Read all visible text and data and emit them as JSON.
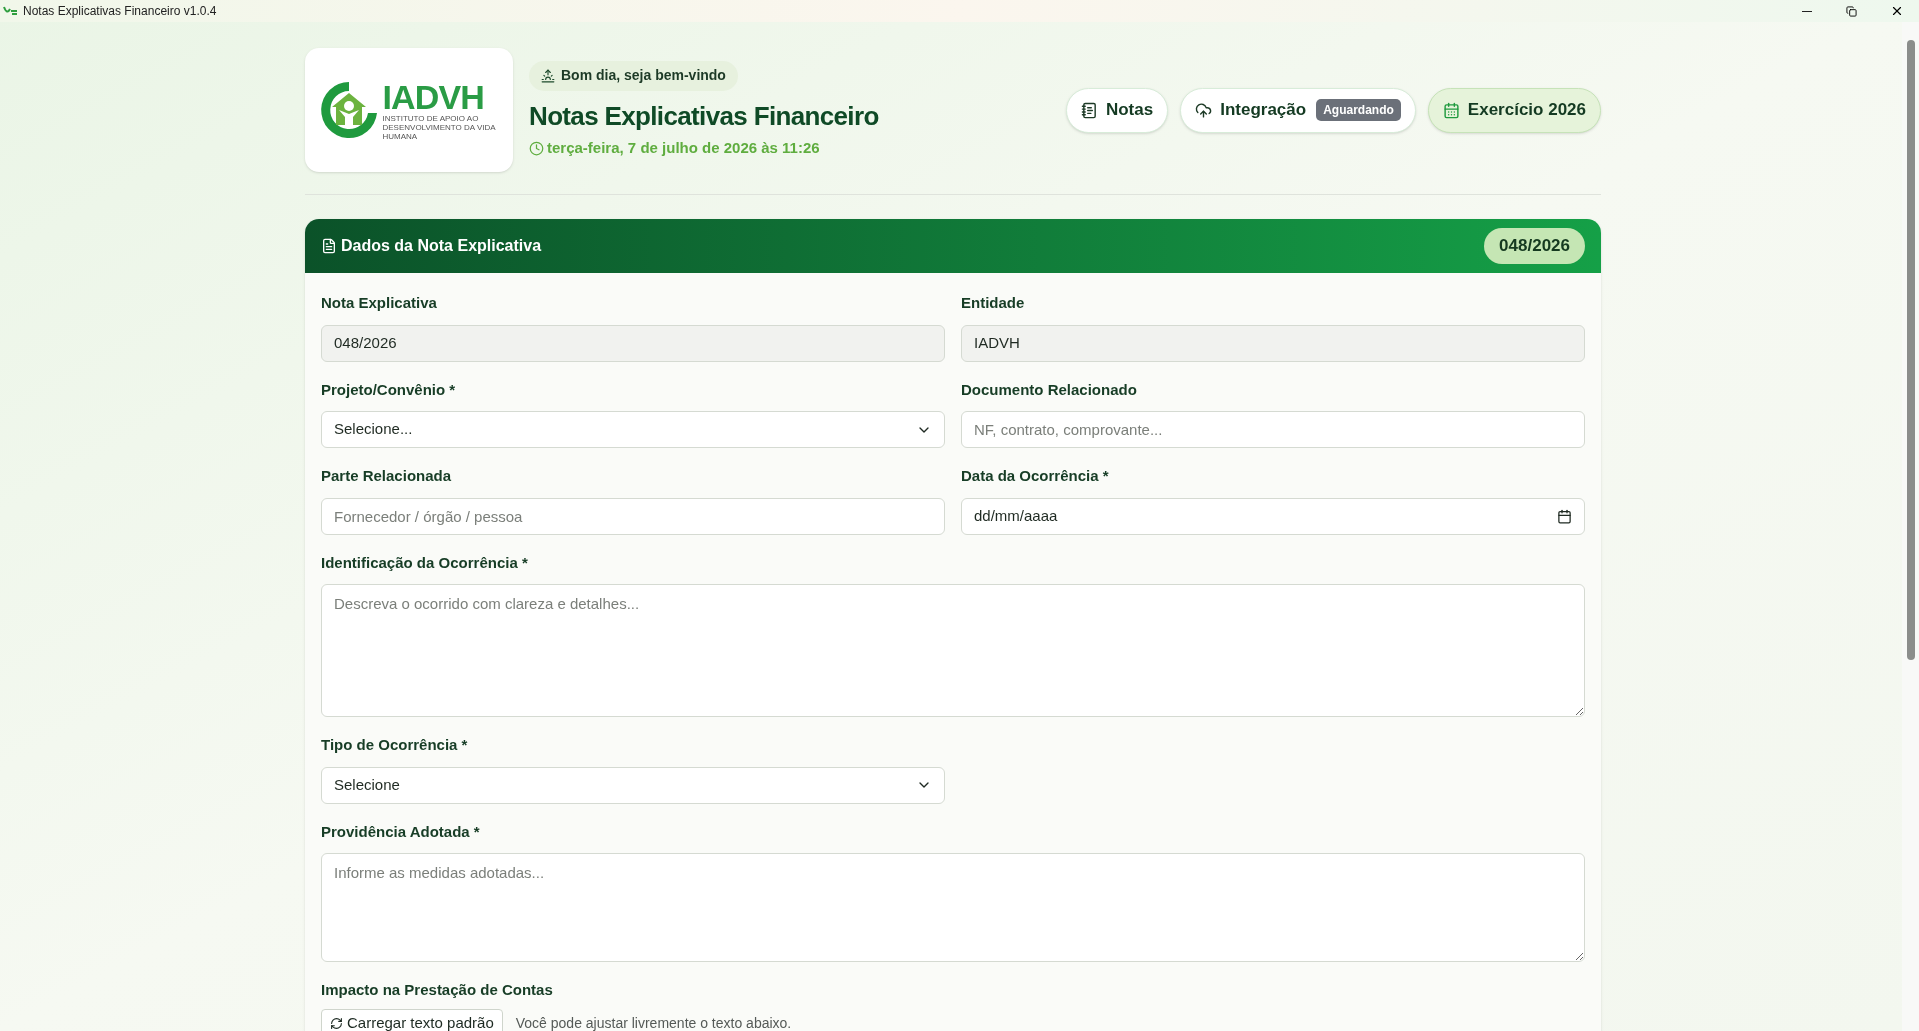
{
  "window": {
    "title": "Notas Explicativas Financeiro v1.0.4"
  },
  "logo": {
    "name": "IADVH",
    "subtitle": "INSTITUTO DE APOIO AO DESENVOLVIMENTO DA VIDA HUMANA"
  },
  "header": {
    "greeting": "Bom dia, seja bem-vindo",
    "title": "Notas Explicativas Financeiro",
    "datetime": "terça-feira, 7 de julho de 2026 às 11:26"
  },
  "nav": [
    {
      "kind": "notes",
      "label": "Notas",
      "selected": false
    },
    {
      "kind": "integration",
      "label": "Integração",
      "badge": "Aguardando",
      "selected": false
    },
    {
      "kind": "year",
      "label": "Exercício 2026",
      "selected": true
    }
  ],
  "card": {
    "title": "Dados da Nota Explicativa",
    "number": "048/2026"
  },
  "rows": [
    [
      {
        "kind": "readonly",
        "label": "Nota Explicativa",
        "value": "048/2026"
      },
      {
        "kind": "readonly",
        "label": "Entidade",
        "value": "IADVH"
      }
    ],
    [
      {
        "kind": "select",
        "label": "Projeto/Convênio *",
        "value": "Selecione..."
      },
      {
        "kind": "text",
        "label": "Documento Relacionado",
        "placeholder": "NF, contrato, comprovante..."
      }
    ],
    [
      {
        "kind": "text",
        "label": "Parte Relacionada",
        "placeholder": "Fornecedor / órgão / pessoa"
      },
      {
        "kind": "date",
        "label": "Data da Ocorrência *",
        "value": "dd/mm/aaaa"
      }
    ],
    [
      {
        "kind": "textarea",
        "label": "Identificação da Ocorrência *",
        "placeholder": "Descreva o ocorrido com clareza e detalhes..."
      }
    ],
    [
      {
        "kind": "select",
        "label": "Tipo de Ocorrência *",
        "value": "Selecione"
      }
    ],
    [
      {
        "kind": "textarea",
        "label": "Providência Adotada *",
        "placeholder": "Informe as medidas adotadas..."
      }
    ]
  ],
  "impact": {
    "label": "Impacto na Prestação de Contas",
    "button": "Carregar texto padrão",
    "hint": "Você pode ajustar livremente o texto abaixo."
  }
}
